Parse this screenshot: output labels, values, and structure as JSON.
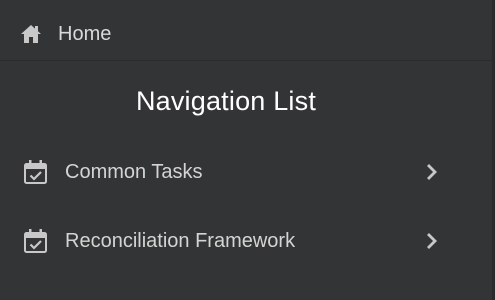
{
  "home": {
    "label": "Home",
    "icon": "home-icon"
  },
  "navigation": {
    "title": "Navigation List",
    "items": [
      {
        "label": "Common Tasks",
        "icon": "calendar-check-icon",
        "trailing_icon": "chevron-right-icon"
      },
      {
        "label": "Reconciliation Framework",
        "icon": "calendar-check-icon",
        "trailing_icon": "chevron-right-icon"
      }
    ]
  },
  "colors": {
    "background": "#333435",
    "text": "#d4d4d4",
    "title": "#ffffff",
    "icon": "#c8c8c8"
  }
}
